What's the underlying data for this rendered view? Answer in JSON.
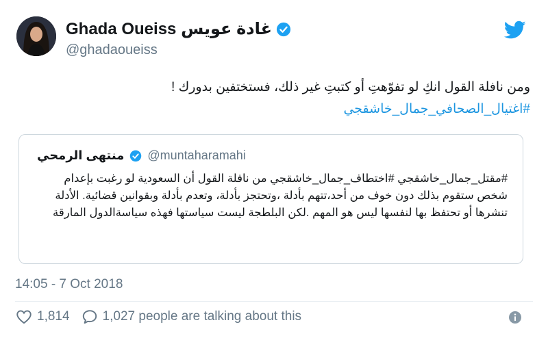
{
  "author": {
    "name": "Ghada Oueiss غادة عويس",
    "handle": "@ghadaoueiss",
    "verified_icon": "verified-badge-icon"
  },
  "tweet": {
    "text": "ومن نافلة القول انكِ لو تفوّهتِ أو كتبتِ غير ذلك، فستختفين بدورك !",
    "hashtag": "#اغتيال_الصحافي_جمال_خاشقجي"
  },
  "quoted": {
    "name": "منتهى الرمحي",
    "handle": "@muntaharamahi",
    "text": "#مقتل_جمال_خاشقجي #اختطاف_جمال_خاشقجي من نافلة القول أن السعودية لو رغبت بإعدام شخص ستقوم بذلك دون خوف من أحد،تتهم بأدلة ،وتحتجز بأدلة، وتعدم بأدلة وبقوانين قضائية. الأدلة تنشرها أو تحتفظ بها لنفسها ليس هو المهم .لكن البلطجة ليست سياستها فهذه سياسةالدول المارقة"
  },
  "timestamp": "14:05 - 7 Oct 2018",
  "actions": {
    "likes": "1,814",
    "replies_text": "1,027 people are talking about this"
  },
  "colors": {
    "link": "#1b95e0",
    "secondary": "#657786",
    "border": "#ccd6dd"
  }
}
